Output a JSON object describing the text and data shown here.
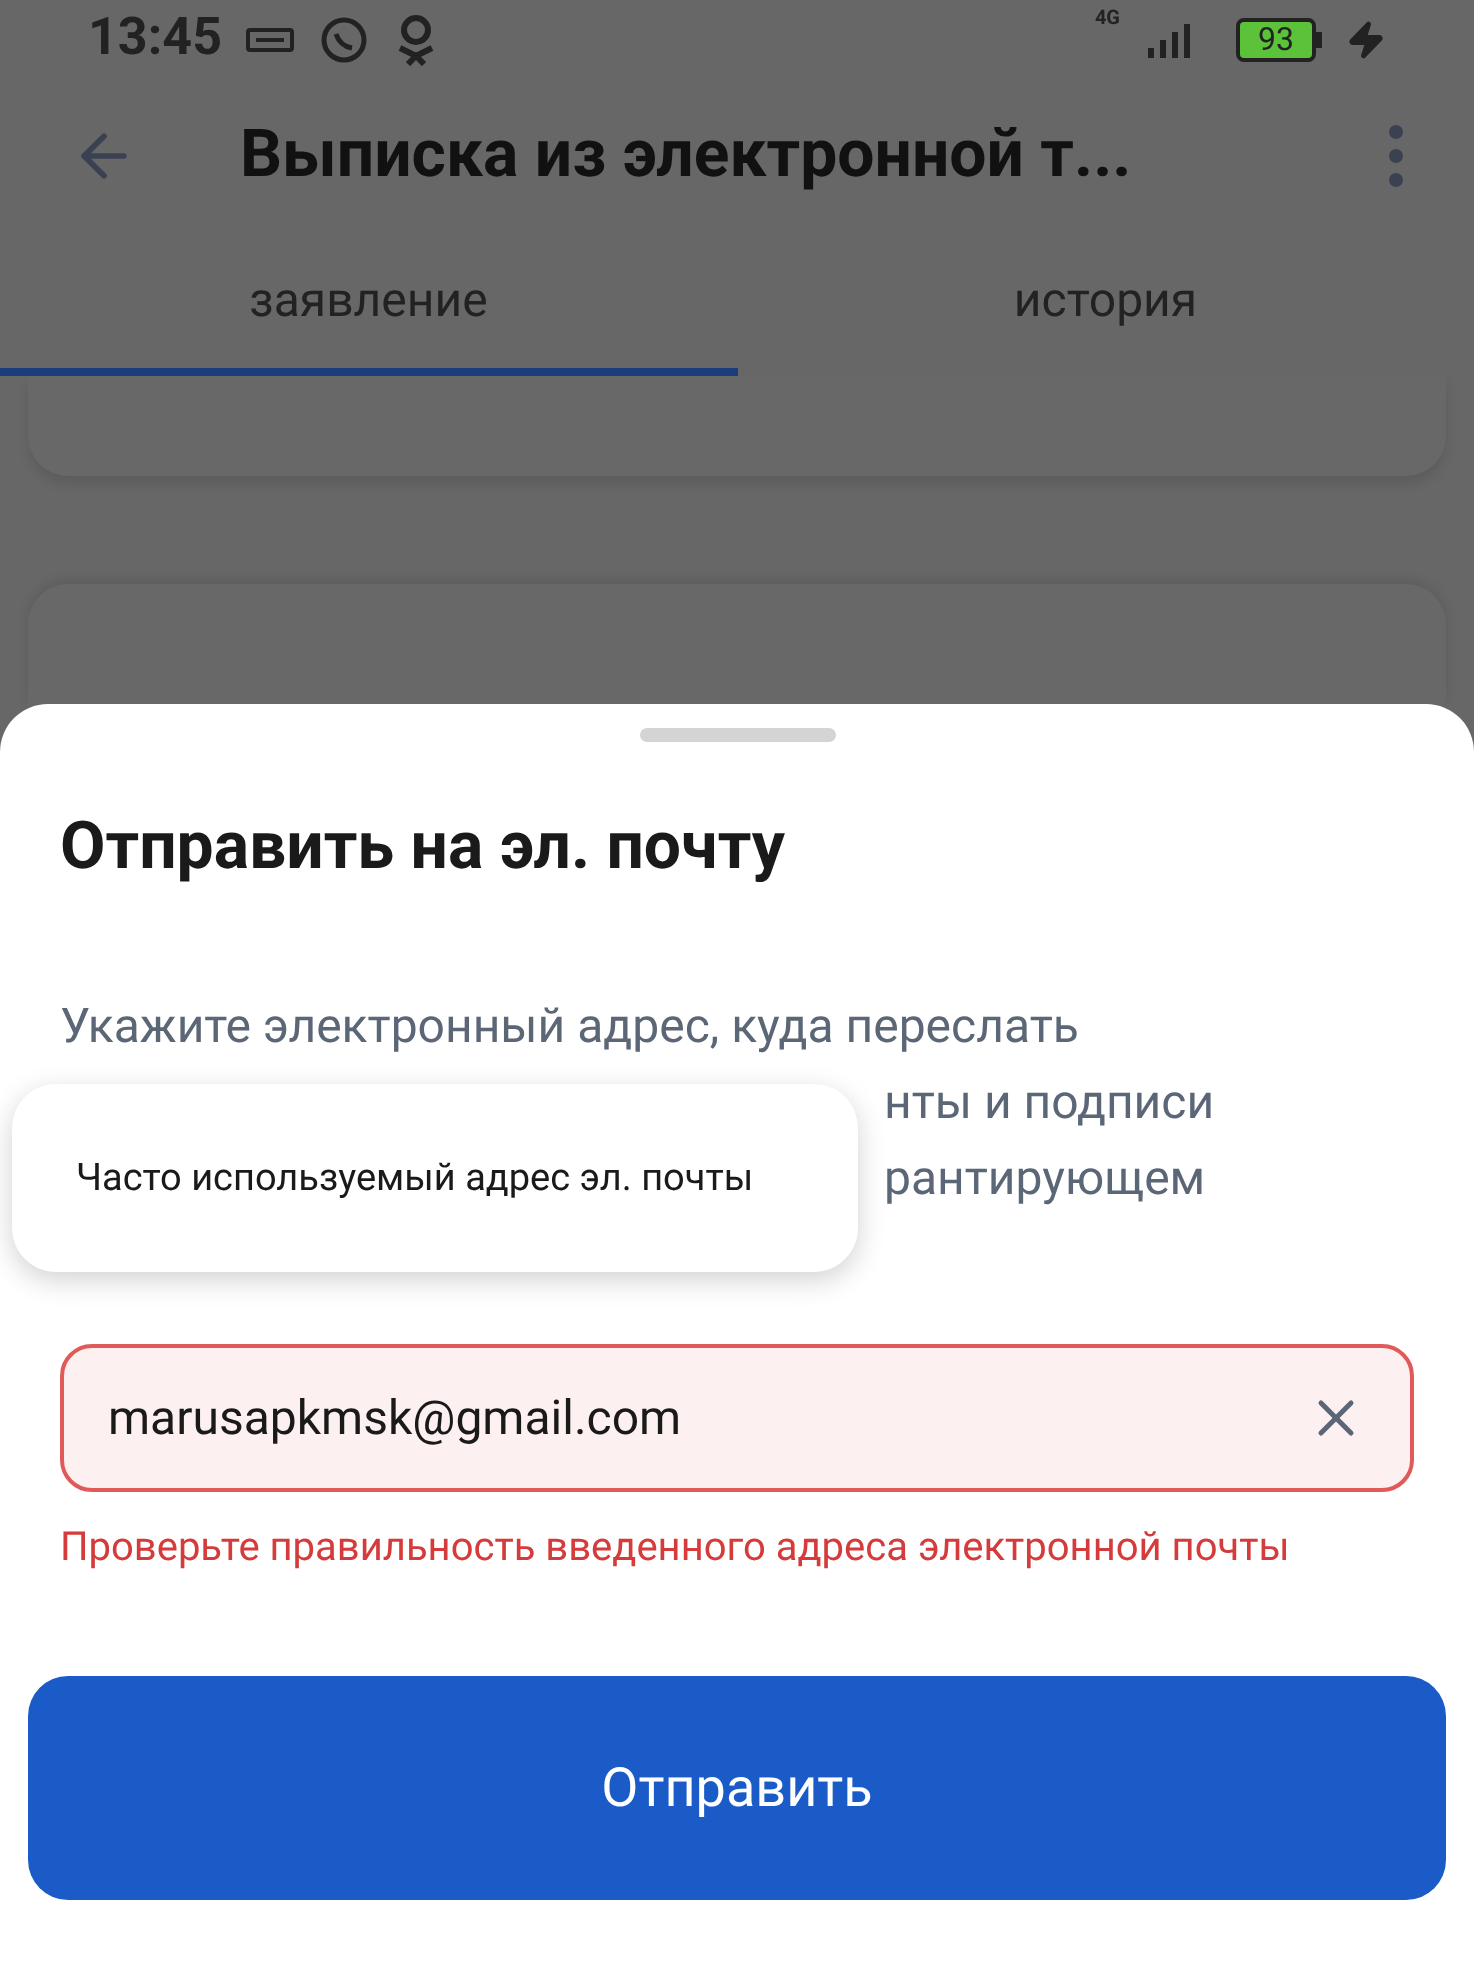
{
  "status_bar": {
    "time": "13:45",
    "network": "4G",
    "battery": "93",
    "charging": true
  },
  "header": {
    "title": "Выписка из электронной т..."
  },
  "tabs": [
    {
      "label": "заявление",
      "selected": true
    },
    {
      "label": "история",
      "selected": false
    }
  ],
  "sheet": {
    "title": "Отправить на эл. почту",
    "description_lines": [
      {
        "text": "Укажите электронный адрес, куда переслать",
        "covered": false
      },
      {
        "text": "нты и подписи",
        "covered": true
      },
      {
        "text": "рантирующем",
        "covered": true
      }
    ],
    "suggestion": {
      "text": "Часто используемый адрес эл. почты"
    },
    "email_field": {
      "value": "marusapkmsk@gmail.com",
      "invalid": true
    },
    "error": "Проверьте правильность введенного адреса электронной почты",
    "submit_button": "Отправить"
  }
}
